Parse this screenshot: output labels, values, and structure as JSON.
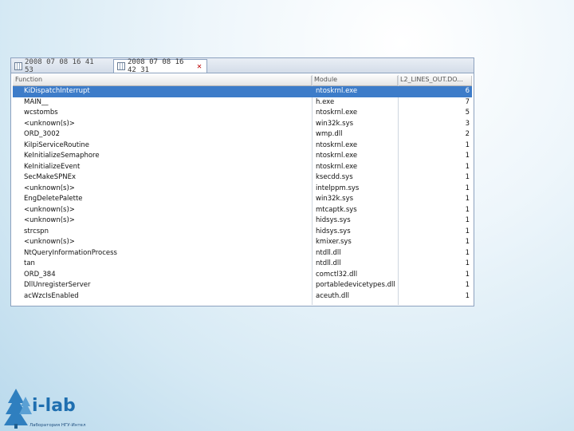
{
  "tabs": [
    {
      "label": "2008 07 08 16 41 53",
      "active": false
    },
    {
      "label": "2008 07 08 16 42 31",
      "active": true,
      "close_glyph": "✕"
    }
  ],
  "table": {
    "columns": [
      "Function",
      "Module",
      "L2_LINES_OUT.DO..."
    ],
    "rows": [
      {
        "function": "KiDispatchInterrupt",
        "module": "ntoskrnl.exe",
        "count": "6",
        "selected": true
      },
      {
        "function": "MAIN__",
        "module": "h.exe",
        "count": "7"
      },
      {
        "function": "wcstombs",
        "module": "ntoskrnl.exe",
        "count": "5"
      },
      {
        "function": "<unknown(s)>",
        "module": "win32k.sys",
        "count": "3"
      },
      {
        "function": "ORD_3002",
        "module": "wmp.dll",
        "count": "2"
      },
      {
        "function": "KiIpiServiceRoutine",
        "module": "ntoskrnl.exe",
        "count": "1"
      },
      {
        "function": "KeInitializeSemaphore",
        "module": "ntoskrnl.exe",
        "count": "1"
      },
      {
        "function": "KeInitializeEvent",
        "module": "ntoskrnl.exe",
        "count": "1"
      },
      {
        "function": "SecMakeSPNEx",
        "module": "ksecdd.sys",
        "count": "1"
      },
      {
        "function": "<unknown(s)>",
        "module": "intelppm.sys",
        "count": "1"
      },
      {
        "function": "EngDeletePalette",
        "module": "win32k.sys",
        "count": "1"
      },
      {
        "function": "<unknown(s)>",
        "module": "mtcaptk.sys",
        "count": "1"
      },
      {
        "function": "<unknown(s)>",
        "module": "hidsys.sys",
        "count": "1"
      },
      {
        "function": "strcspn",
        "module": "hidsys.sys",
        "count": "1"
      },
      {
        "function": "<unknown(s)>",
        "module": "kmixer.sys",
        "count": "1"
      },
      {
        "function": "NtQueryInformationProcess",
        "module": "ntdll.dll",
        "count": "1"
      },
      {
        "function": "tan",
        "module": "ntdll.dll",
        "count": "1"
      },
      {
        "function": "ORD_384",
        "module": "comctl32.dll",
        "count": "1"
      },
      {
        "function": "DllUnregisterServer",
        "module": "portabledevicetypes.dll",
        "count": "1"
      },
      {
        "function": "acWzcIsEnabled",
        "module": "aceuth.dll",
        "count": "1"
      }
    ]
  },
  "logo": {
    "text": "i-lab",
    "subtitle": "Лаборатория НГУ-Интел",
    "icon": "tree-icon",
    "brand_color": "#1f6fb0"
  },
  "colors": {
    "selection": "#3d7cc9"
  }
}
